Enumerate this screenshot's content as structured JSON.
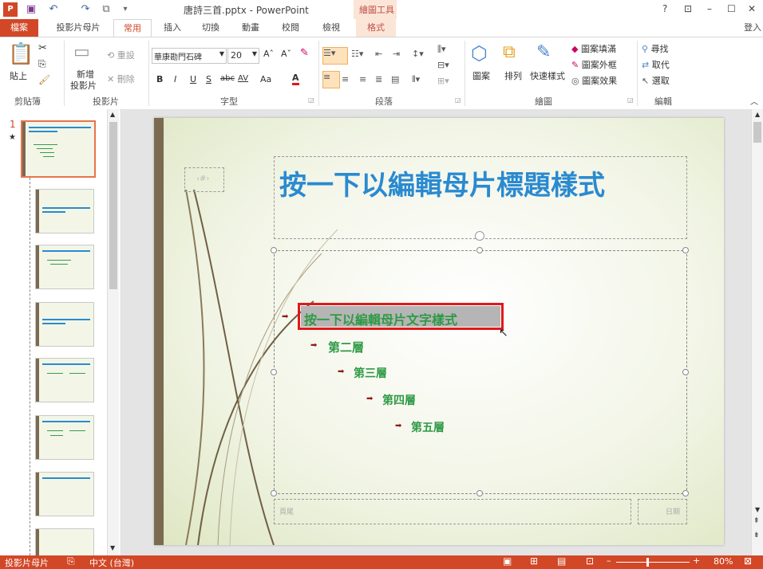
{
  "window": {
    "title": "唐詩三首.pptx - PowerPoint",
    "context_tab_group": "繪圖工具",
    "login": "登入",
    "help": "?"
  },
  "tabs": [
    "檔案",
    "投影片母片",
    "常用",
    "插入",
    "切換",
    "動畫",
    "校閱",
    "檢視",
    "格式"
  ],
  "ribbon": {
    "clipboard": {
      "paste": "貼上",
      "label": "剪貼簿"
    },
    "slides": {
      "new_slide_l1": "新增",
      "new_slide_l2": "投影片",
      "reset": "重設",
      "delete": "刪除",
      "label": "投影片"
    },
    "font": {
      "font_name": "華康勘門石碑",
      "font_size": "20",
      "bold": "B",
      "italic": "I",
      "underline": "U",
      "shadow": "S",
      "strike": "abc",
      "spacing": "AV",
      "case": "Aa",
      "color": "A",
      "label": "字型"
    },
    "paragraph": {
      "label": "段落"
    },
    "drawing": {
      "shapes": "圖案",
      "arrange": "排列",
      "quick_styles": "快速樣式",
      "fill": "圖案填滿",
      "outline": "圖案外框",
      "effects": "圖案效果",
      "label": "繪圖"
    },
    "editing": {
      "find": "尋找",
      "replace": "取代",
      "select": "選取",
      "label": "編輯"
    }
  },
  "slide_pane": {
    "current_slide_number": "1",
    "star": "★"
  },
  "slide": {
    "title": "按一下以編輯母片標題樣式",
    "slide_number_placeholder": "‹#›",
    "body_levels": [
      "按一下以編輯母片文字樣式",
      "第二層",
      "第三層",
      "第四層",
      "第五層"
    ],
    "footer": "頁尾",
    "date": "日期"
  },
  "status": {
    "view": "投影片母片",
    "language": "中文 (台灣)",
    "zoom": "80%"
  },
  "colors": {
    "accent": "#d24726",
    "title_blue": "#2a8ad0",
    "body_green": "#2e9a45",
    "highlight": "#e0191a"
  }
}
